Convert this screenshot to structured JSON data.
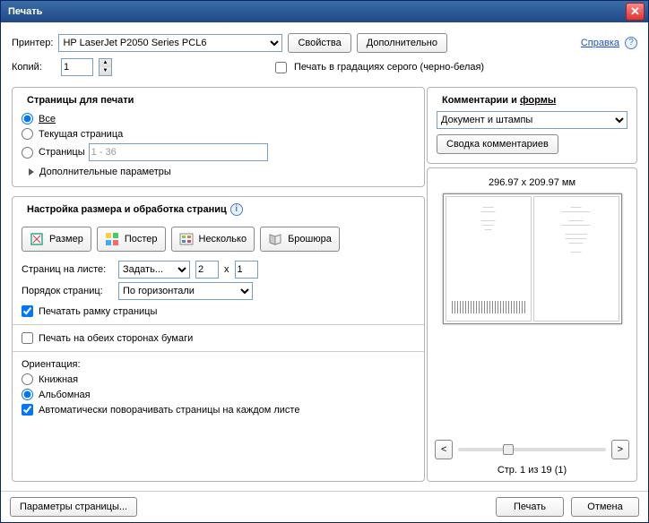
{
  "title": "Печать",
  "help_label": "Справка",
  "header": {
    "printer_label": "Принтер:",
    "printer_value": "HP LaserJet P2050 Series PCL6",
    "properties_btn": "Свойства",
    "advanced_btn": "Дополнительно",
    "copies_label": "Копий:",
    "copies_value": "1",
    "grayscale_label": "Печать в градациях серого (черно-белая)"
  },
  "pages": {
    "title": "Страницы для печати",
    "all": "Все",
    "current": "Текущая страница",
    "pages_label": "Страницы",
    "pages_range": "1 - 36",
    "more": "Дополнительные параметры"
  },
  "sizing": {
    "title": "Настройка размера и обработка страниц",
    "btn_size": "Размер",
    "btn_poster": "Постер",
    "btn_multiple": "Несколько",
    "btn_booklet": "Брошюра",
    "pps_label": "Страниц на листе:",
    "pps_select": "Задать...",
    "pps_cols": "2",
    "pps_x": "x",
    "pps_rows": "1",
    "order_label": "Порядок страниц:",
    "order_value": "По горизонтали",
    "frame_label": "Печатать рамку страницы",
    "duplex_label": "Печать на обеих сторонах бумаги",
    "orient_label": "Ориентация:",
    "orient_portrait": "Книжная",
    "orient_landscape": "Альбомная",
    "auto_rotate": "Автоматически поворачивать страницы на каждом листе"
  },
  "comments": {
    "title": "Комментарии и формы",
    "value": "Документ и штампы",
    "summary_btn": "Сводка комментариев"
  },
  "preview": {
    "dim": "296.97 x 209.97 мм",
    "prev_btn": "<",
    "next_btn": ">",
    "page_info": "Стр. 1 из 19 (1)"
  },
  "footer": {
    "page_setup": "Параметры страницы...",
    "print": "Печать",
    "cancel": "Отмена"
  }
}
